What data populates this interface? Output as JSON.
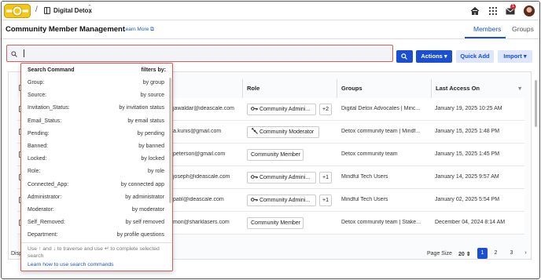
{
  "header": {
    "breadcrumb_sep": "/",
    "workspace_name": "Digital Detox",
    "notification_count": "1"
  },
  "page": {
    "title": "Community Member Management",
    "learn_more": "Learn More",
    "tabs": [
      {
        "label": "Members",
        "active": true
      },
      {
        "label": "Groups",
        "active": false
      }
    ]
  },
  "toolbar": {
    "search_value": "",
    "actions_label": "Actions",
    "quick_add_label": "Quick Add",
    "import_label": "Import"
  },
  "table": {
    "columns": [
      "Role",
      "Groups",
      "Last Access On"
    ],
    "rows": [
      {
        "email": "jawaldar@ideascale.com",
        "role": "Community Admini...",
        "role_icon": "key-icon",
        "extra": "+2",
        "groups": "Digital Detox Advocates | Minc...",
        "last_access": "January 19, 2025 10:25 AM"
      },
      {
        "email": "a.kunis@gmail.com",
        "role": "Community Moderator",
        "role_icon": "gavel-icon",
        "extra": "",
        "groups": "Detox community team | Mindf...",
        "last_access": "January 15, 2025 1:48 PM"
      },
      {
        "email": "peterson@gmail.com",
        "role": "Community Member",
        "role_icon": "",
        "extra": "",
        "groups": "Detox community team",
        "last_access": "January 15, 2025 1:45 PM"
      },
      {
        "email": "joseph@ideascale.com",
        "role": "Community Admini...",
        "role_icon": "key-icon",
        "extra": "+1",
        "groups": "Mindful Tech Users",
        "last_access": "January 14, 2025 9:57 AM"
      },
      {
        "email": "patil@ideascale.com",
        "role": "Community Admini...",
        "role_icon": "key-icon",
        "extra": "+1",
        "groups": "Mindful Tech Users",
        "last_access": "January 02, 2025 5:54 PM"
      },
      {
        "email": "mon@sharklasers.com",
        "role": "Community Member",
        "role_icon": "",
        "extra": "",
        "groups": "Detox community team | Stake...",
        "last_access": "December 04, 2024 8:14 AM"
      }
    ]
  },
  "search_help": {
    "header_left": "Search Command",
    "header_right": "filters by:",
    "commands": [
      {
        "key": "Group:",
        "desc": "by group"
      },
      {
        "key": "Source:",
        "desc": "by source"
      },
      {
        "key": "Invitation_Status:",
        "desc": "by invitation status"
      },
      {
        "key": "Email_Status:",
        "desc": "by email status"
      },
      {
        "key": "Pending:",
        "desc": "by pending"
      },
      {
        "key": "Banned:",
        "desc": "by banned"
      },
      {
        "key": "Locked:",
        "desc": "by locked"
      },
      {
        "key": "Role:",
        "desc": "by role"
      },
      {
        "key": "Connected_App:",
        "desc": "by connected app"
      },
      {
        "key": "Administrator:",
        "desc": "by administrator"
      },
      {
        "key": "Moderator:",
        "desc": "by moderator"
      },
      {
        "key": "Self_Removed:",
        "desc": "by self removed"
      },
      {
        "key": "Department:",
        "desc": "by profile questions"
      }
    ],
    "hint": "Use ↑ and ↓ to traverse and use ↵ to complete selected search",
    "link": "Learn how to use search commands"
  },
  "footer": {
    "display_prefix": "Disp",
    "page_size_label": "Page Size",
    "page_size": "20",
    "pages": [
      "1",
      "2",
      "3"
    ],
    "active_page": "1"
  },
  "colors": {
    "accent": "#1a4fd1",
    "highlight_border": "#e05a5a"
  }
}
